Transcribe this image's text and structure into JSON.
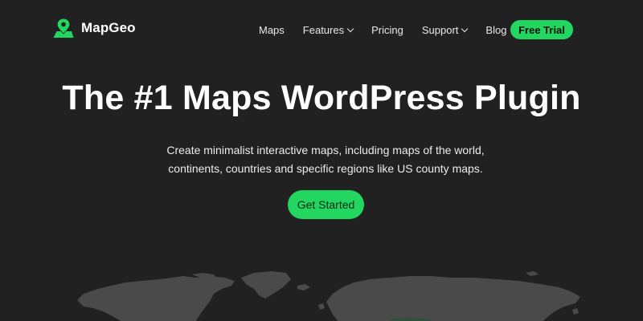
{
  "brand": {
    "name": "MapGeo",
    "logo_icon": "map-pin-icon"
  },
  "nav": {
    "items": [
      {
        "label": "Maps",
        "has_dropdown": false
      },
      {
        "label": "Features",
        "has_dropdown": true
      },
      {
        "label": "Pricing",
        "has_dropdown": false
      },
      {
        "label": "Support",
        "has_dropdown": true
      },
      {
        "label": "Blog",
        "has_dropdown": false
      }
    ],
    "cta_label": "Free Trial"
  },
  "hero": {
    "title": "The #1 Maps WordPress Plugin",
    "subtitle_line1": "Create minimalist interactive maps, including maps of the world,",
    "subtitle_line2": "continents, countries and specific regions like US county maps.",
    "button_label": "Get Started"
  },
  "colors": {
    "background": "#212121",
    "accent": "#22d660",
    "map_land": "#4a4a4a"
  }
}
